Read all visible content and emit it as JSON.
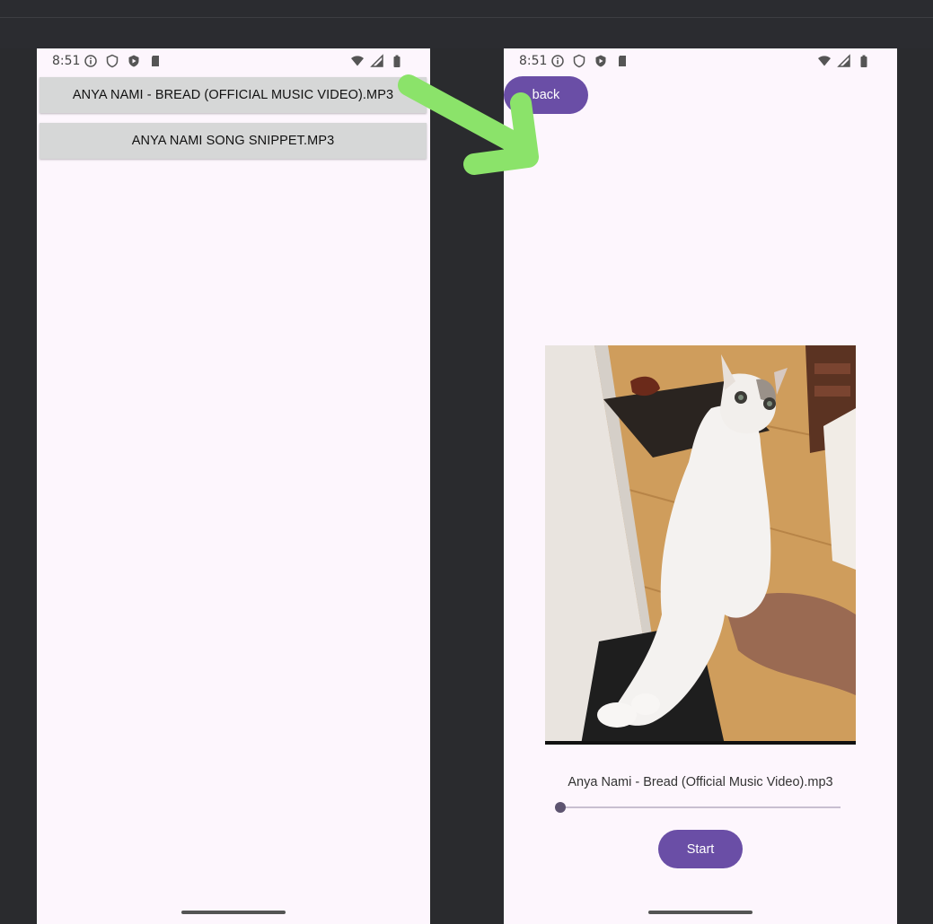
{
  "left_screen": {
    "status_time": "8:51",
    "song_list": [
      {
        "label": "ANYA NAMI - BREAD (OFFICIAL MUSIC VIDEO).MP3"
      },
      {
        "label": "ANYA NAMI SONG SNIPPET.MP3"
      }
    ]
  },
  "right_screen": {
    "status_time": "8:51",
    "back_label": "back",
    "track_title": "Anya Nami - Bread (Official Music Video).mp3",
    "progress": 0.0,
    "start_label": "Start"
  },
  "colors": {
    "accent": "#6a4ea6",
    "arrow": "#8be36a",
    "screen_bg": "#fdf6fd",
    "list_button_bg": "#d6d7d7"
  }
}
